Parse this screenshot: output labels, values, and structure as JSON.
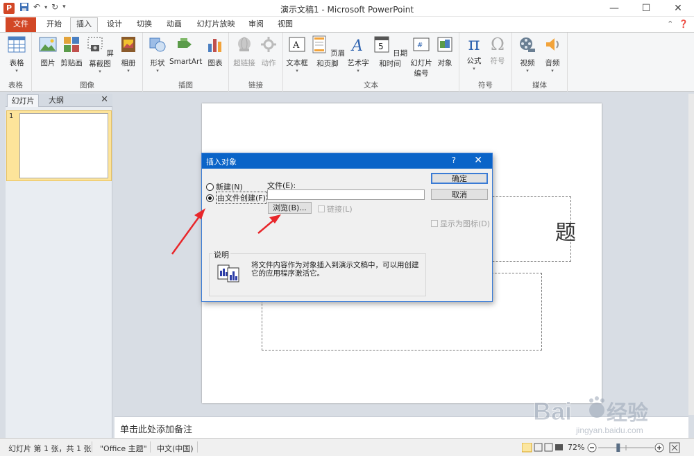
{
  "window": {
    "title": "演示文稿1 - Microsoft PowerPoint",
    "app_icon_letter": "P",
    "controls": [
      "—",
      "☐",
      "✕"
    ]
  },
  "tabs": [
    {
      "label": "文件",
      "type": "file"
    },
    {
      "label": "开始"
    },
    {
      "label": "插入",
      "active": true
    },
    {
      "label": "设计"
    },
    {
      "label": "切换"
    },
    {
      "label": "动画"
    },
    {
      "label": "幻灯片放映"
    },
    {
      "label": "审阅"
    },
    {
      "label": "视图"
    }
  ],
  "ribbon": {
    "groups": {
      "table": "表格",
      "images": "图像",
      "illustrations": "插图",
      "links": "链接",
      "text": "文本",
      "symbols": "符号",
      "media": "媒体"
    },
    "buttons": {
      "table": "表格",
      "picture": "图片",
      "clipart": "剪贴画",
      "screenshot": "屏幕截图",
      "album": "相册",
      "shapes": "形状",
      "smartart": "SmartArt",
      "chart": "图表",
      "hyperlink": "超链接",
      "action": "动作",
      "textbox": "文本框",
      "header_footer": "页眉和页脚",
      "wordart": "艺术字",
      "datetime": "日期和时间",
      "slide_number_1": "幻灯片",
      "slide_number_2": "编号",
      "object": "对象",
      "equation": "公式",
      "symbol": "符号",
      "video": "视频",
      "audio": "音频"
    }
  },
  "left_pane": {
    "tab_slides": "幻灯片",
    "tab_outline": "大纲",
    "close": "✕",
    "thumb_number": "1"
  },
  "slide": {
    "title_fragment": "题"
  },
  "notes": {
    "placeholder": "单击此处添加备注"
  },
  "status": {
    "slide_info": "幻灯片 第 1 张，共 1 张",
    "theme": "\"Office 主题\"",
    "language": "中文(中国)",
    "zoom": "72%",
    "zoom_level_fraction": 0.72
  },
  "dialog": {
    "title": "插入对象",
    "help": "?",
    "close": "✕",
    "radio_new": "新建(N)",
    "radio_from_file": "由文件创建(F)",
    "file_label": "文件(E):",
    "file_value": "",
    "browse": "浏览(B)...",
    "link": "链接(L)",
    "ok": "确定",
    "cancel": "取消",
    "display_as_icon": "显示为图标(D)",
    "description_label": "说明",
    "description_text": "将文件内容作为对象插入到演示文稿中，可以用创建它的应用程序激活它。"
  },
  "watermark": {
    "brand": "Bai du 经验",
    "url": "jingyan.baidu.com"
  },
  "colors": {
    "file_tab": "#d24726",
    "dialog_title": "#0a64c8",
    "arrow": "#e8262a"
  }
}
